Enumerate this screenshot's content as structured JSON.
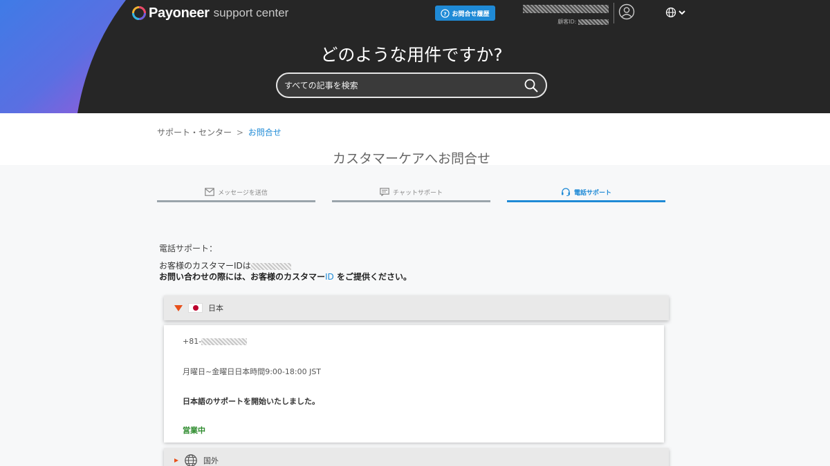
{
  "header": {
    "logo_word": "Payoneer",
    "logo_sub": "support center",
    "history_button": "お問合せ履歴",
    "customer_id_label": "顧客ID:",
    "hero_title": "どのような用件ですか?",
    "search_placeholder": "すべての記事を検索"
  },
  "breadcrumb": {
    "home": "サポート・センター",
    "separator": ">",
    "current": "お問合せ"
  },
  "page_title": "カスタマーケアへお問合せ",
  "tabs": [
    {
      "label": "メッセージを送信",
      "icon": "mail-icon",
      "active": false
    },
    {
      "label": "チャットサポート",
      "icon": "chat-icon",
      "active": false
    },
    {
      "label": "電話サポート",
      "icon": "headset-icon",
      "active": true
    }
  ],
  "intro": {
    "heading": "電話サポート：",
    "customer_id_line": "お客様のカスタマーIDは",
    "instruction_prefix": "お問い合わせの際には、お客様のカスタマー",
    "instruction_id": "ID",
    "instruction_suffix": " をご提供ください。"
  },
  "regions": [
    {
      "name": "日本",
      "expanded": true,
      "phone_prefix": "+81-",
      "hours": "月曜日~金曜日日本時間9:00-18:00 JST",
      "notice": "日本語のサポートを開始いたしました。",
      "status": "営業中"
    },
    {
      "name": "国外",
      "expanded": false
    }
  ],
  "colors": {
    "header_bg": "#262626",
    "accent": "#1f8ad6",
    "open_status": "#2b8a2b",
    "arrow": "#e8501a"
  }
}
